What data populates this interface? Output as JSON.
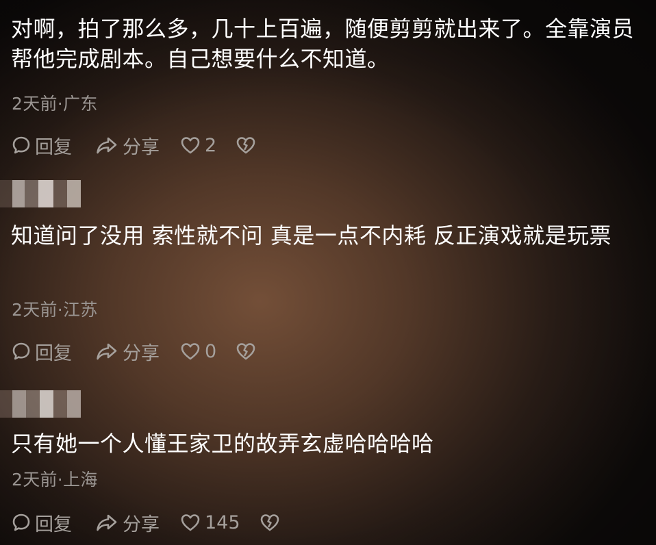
{
  "comments": [
    {
      "text": "对啊，拍了那么多，几十上百遍，随便剪剪就出来了。全靠演员帮他完成剧本。自己想要什么不知道。",
      "meta": "2天前·广东",
      "reply_label": "回复",
      "share_label": "分享",
      "like_count": "2"
    },
    {
      "text": "知道问了没用 索性就不问 真是一点不内耗 反正演戏就是玩票",
      "meta": "2天前·江苏",
      "reply_label": "回复",
      "share_label": "分享",
      "like_count": "0"
    },
    {
      "text": "只有她一个人懂王家卫的故弄玄虚哈哈哈哈",
      "meta": "2天前·上海",
      "reply_label": "回复",
      "share_label": "分享",
      "like_count": "145"
    }
  ],
  "icons": {
    "reply": "speech-bubble-icon",
    "share": "share-arrow-icon",
    "like": "heart-icon",
    "dislike": "broken-heart-icon"
  },
  "colors": {
    "text": "#ffffff",
    "meta": "#9a9592",
    "actions": "#a5a09c"
  }
}
